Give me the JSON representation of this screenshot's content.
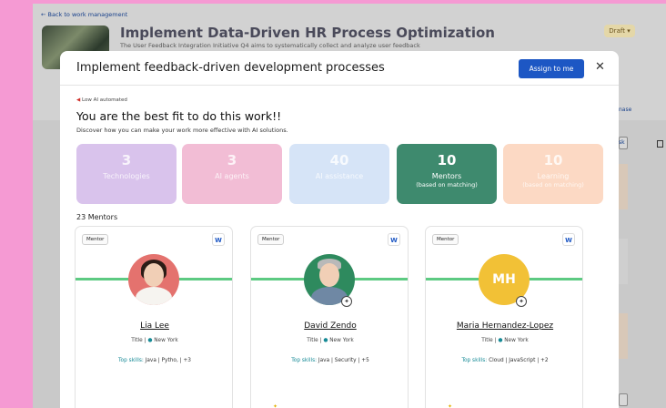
{
  "background": {
    "back_link": "← Back to work management",
    "title": "Implement Data-Driven HR Process Optimization",
    "subtitle": "The User Feedback Integration Initiative Q4 aims to systematically collect and analyze user feedback",
    "status": "Draft",
    "fragment_1": "nase",
    "fragment_2": "sk"
  },
  "modal": {
    "title": "Implement feedback-driven development  processes",
    "assign_label": "Assign to me",
    "close_glyph": "✕",
    "badge": "Low AI automated",
    "headline": "You are the best fit to do this work!!",
    "subheadline": "Discover how you can make your work more effective with AI solutions.",
    "stats": [
      {
        "number": "3",
        "label": "Technologies",
        "color": "#d9c3ec"
      },
      {
        "number": "3",
        "label": "AI agents",
        "color": "#f2bdd5"
      },
      {
        "number": "40",
        "label": "AI assistance",
        "color": "#d6e4f7"
      },
      {
        "number": "10",
        "label": "Mentors",
        "sublabel": "(based on matching)",
        "color": "#3e8a6e"
      },
      {
        "number": "10",
        "label": "Learning",
        "sublabel": "(based on matching)",
        "color": "#fcd9c4"
      }
    ],
    "count_label": "23 Mentors",
    "mentors": [
      {
        "tag": "Mentor",
        "initials": "",
        "name": "Lia Lee",
        "title": "Title",
        "location": "New York",
        "skills_label": "Top skills:",
        "skills": "Java  |  Pytho,  |  +3"
      },
      {
        "tag": "Mentor",
        "initials": "",
        "name": "David Zendo",
        "title": "Title",
        "location": "New York",
        "skills_label": "Top skills:",
        "skills": "Java  |  Security  |  +5"
      },
      {
        "tag": "Mentor",
        "initials": "MH",
        "name": "Maria Hernandez-Lopez",
        "title": "Title",
        "location": "New York",
        "skills_label": "Top skills:",
        "skills": "Cloud  |  JavaScript  |  +2"
      }
    ],
    "icon_letter": "W"
  },
  "colors": {
    "page_bg": "#f59ad3",
    "primary": "#1d57c4",
    "mentor_line": "#5dca82",
    "teal": "#168a96"
  }
}
